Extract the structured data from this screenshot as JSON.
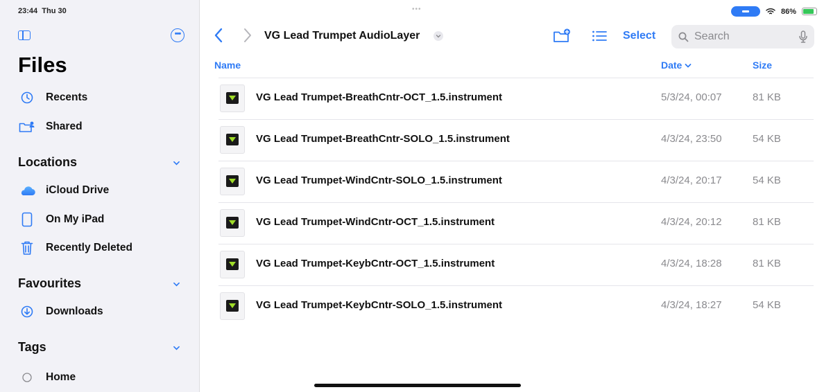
{
  "status": {
    "time": "23:44",
    "day": "Thu 30",
    "battery": "86%",
    "dots": "•••"
  },
  "sidebar": {
    "title": "Files",
    "items": [
      {
        "label": "Recents",
        "icon": "clock-icon"
      },
      {
        "label": "Shared",
        "icon": "shared-folder-icon"
      }
    ],
    "locations": {
      "heading": "Locations",
      "items": [
        {
          "label": "iCloud Drive",
          "icon": "cloud-icon"
        },
        {
          "label": "On My iPad",
          "icon": "ipad-icon"
        },
        {
          "label": "Recently Deleted",
          "icon": "trash-icon"
        }
      ]
    },
    "favourites": {
      "heading": "Favourites",
      "items": [
        {
          "label": "Downloads",
          "icon": "download-icon"
        }
      ]
    },
    "tags": {
      "heading": "Tags",
      "items": [
        {
          "label": "Home",
          "icon": "tag-circle-icon"
        }
      ]
    }
  },
  "toolbar": {
    "folder_title": "VG Lead Trumpet AudioLayer",
    "select_label": "Select",
    "search_placeholder": "Search"
  },
  "columns": {
    "name": "Name",
    "date": "Date",
    "size": "Size"
  },
  "files": [
    {
      "name": "VG Lead Trumpet-BreathCntr-OCT_1.5.instrument",
      "date": "5/3/24, 00:07",
      "size": "81 KB"
    },
    {
      "name": "VG Lead Trumpet-BreathCntr-SOLO_1.5.instrument",
      "date": "4/3/24, 23:50",
      "size": "54 KB"
    },
    {
      "name": "VG Lead Trumpet-WindCntr-SOLO_1.5.instrument",
      "date": "4/3/24, 20:17",
      "size": "54 KB"
    },
    {
      "name": "VG Lead Trumpet-WindCntr-OCT_1.5.instrument",
      "date": "4/3/24, 20:12",
      "size": "81 KB"
    },
    {
      "name": "VG Lead Trumpet-KeybCntr-OCT_1.5.instrument",
      "date": "4/3/24, 18:28",
      "size": "81 KB"
    },
    {
      "name": "VG Lead Trumpet-KeybCntr-SOLO_1.5.instrument",
      "date": "4/3/24, 18:27",
      "size": "54 KB"
    }
  ],
  "colors": {
    "accent": "#2f7bf5",
    "badge_green": "#9fdc28"
  }
}
